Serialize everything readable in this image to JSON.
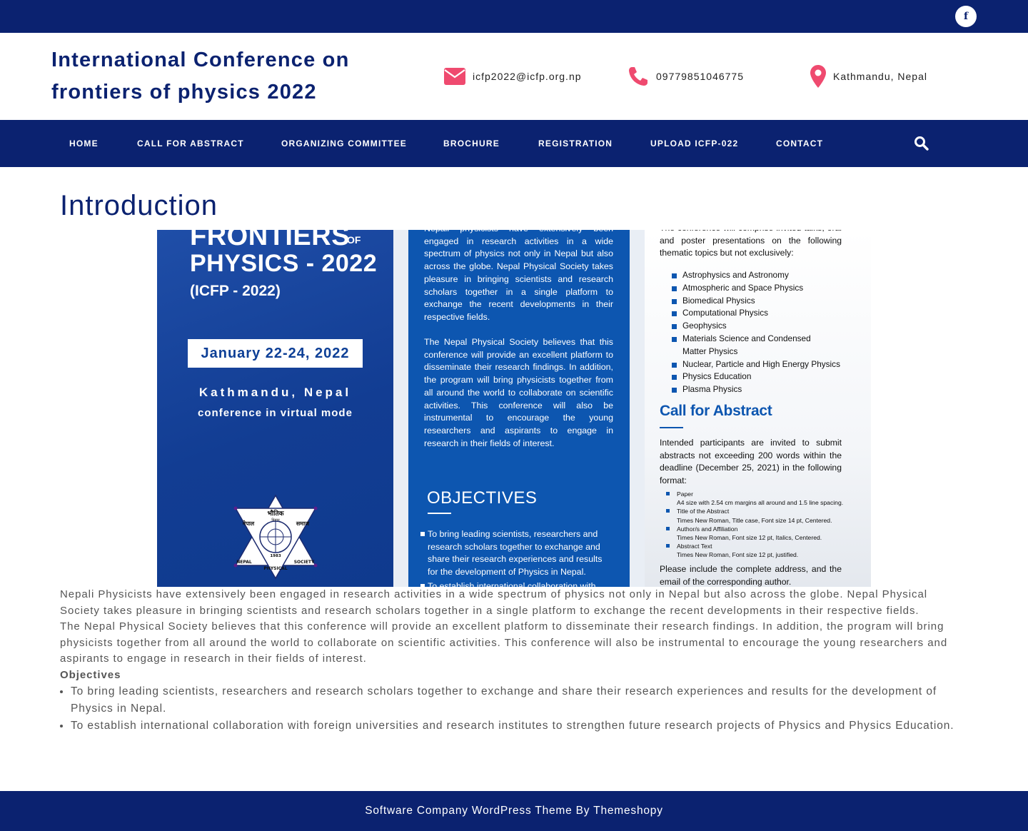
{
  "topbar": {
    "facebook_icon": "facebook-icon",
    "facebook_glyph": "f"
  },
  "header": {
    "title": "International Conference on frontiers of physics 2022",
    "email": {
      "icon": "envelope-icon",
      "text": "icfp2022@icfp.org.np"
    },
    "phone": {
      "icon": "phone-icon",
      "text": "09779851046775"
    },
    "location": {
      "icon": "map-marker-icon",
      "text": "Kathmandu, Nepal"
    }
  },
  "nav": {
    "items": [
      {
        "label": "HOME"
      },
      {
        "label": "CALL FOR ABSTRACT"
      },
      {
        "label": "ORGANIZING COMMITTEE"
      },
      {
        "label": "BROCHURE"
      },
      {
        "label": "REGISTRATION"
      },
      {
        "label": "UPLOAD ICFP-022"
      },
      {
        "label": "CONTACT"
      }
    ],
    "search_icon": "search-icon"
  },
  "page": {
    "title": "Introduction"
  },
  "poster": {
    "left": {
      "title_line1": "FRONTIERS",
      "title_of": "OF",
      "title_line2": "PHYSICS - 2022",
      "abbr": "(ICFP - 2022)",
      "dates": "January 22-24, 2022",
      "location": "Kathmandu, Nepal",
      "mode": "conference in virtual mode",
      "logo": {
        "top": "भौतिक",
        "sub": "विज्ञान",
        "left": "नेपाल",
        "right": "समाज",
        "year": "1983",
        "bottom_left": "NEPAL",
        "bottom_right": "SOCIETY",
        "bottom": "PHYSICAL"
      }
    },
    "middle": {
      "para1": "Nepali physicists have extensively been engaged in research activities in a wide spectrum of physics not only in Nepal but also across the globe. Nepal Physical Society takes pleasure in bringing scientists and research scholars together in a single platform to exchange the recent developments in their respective fields.",
      "para2": "The Nepal Physical Society believes that this conference will provide an excellent platform to disseminate their research findings. In addition, the program will bring physicists together from all around the world to collaborate on scientific activities. This conference will also be instrumental to encourage the young researchers and aspirants to engage in research in their fields of interest.",
      "objectives_title": "OBJECTIVES",
      "objective1": "To bring leading scientists, researchers and research scholars together to exchange and share their research experiences and results for the development of Physics in Nepal.",
      "objective2": "To establish international collaboration with"
    },
    "right": {
      "intro": "The conference will comprise invited talks, oral and poster presentations on the following thematic topics but not exclusively:",
      "topics": [
        "Astrophysics and Astronomy",
        "Atmospheric and Space Physics",
        "Biomedical Physics",
        "Computational Physics",
        "Geophysics",
        "Materials Science and Condensed Matter Physics",
        "Nuclear, Particle and High Energy Physics",
        "Physics Education",
        "Plasma Physics"
      ],
      "call_title": "Call for Abstract",
      "call_text": "Intended participants are invited to submit abstracts not exceeding 200 words within the deadline (December 25, 2021) in the following format:",
      "format": [
        {
          "head": "Paper",
          "detail": "A4 size with 2.54 cm margins all around and 1.5 line spacing."
        },
        {
          "head": "Title of the Abstract",
          "detail": "Times New Roman, Title case, Font size 14 pt, Centered."
        },
        {
          "head": "Author/s and Affiliation",
          "detail": "Times New Roman, Font size 12 pt, Italics, Centered."
        },
        {
          "head": "Abstract Text",
          "detail": "Times New Roman, Font size 12 pt, justified."
        }
      ],
      "closing": "Please include the complete address, and the email of the corresponding author."
    }
  },
  "content": {
    "para1": "Nepali Physicists have extensively been engaged in research activities in a wide spectrum of physics not only in Nepal but also across the globe. Nepal Physical Society takes pleasure in bringing scientists and research scholars together in a single platform to exchange the recent developments in their respective fields.",
    "para2": "The Nepal Physical Society believes that this conference will provide an excellent platform to disseminate their research findings. In addition, the program will bring physicists together from all around the world to collaborate on scientific activities. This conference will also be instrumental to encourage the young researchers and aspirants to engage in research in their fields of interest.",
    "objectives_heading": "Objectives",
    "objectives": [
      "To bring leading scientists, researchers and research scholars together to exchange and share their research experiences and results for the development of Physics in Nepal.",
      "To establish international collaboration with foreign universities and research institutes to strengthen future research projects of Physics and Physics Education."
    ]
  },
  "footer": {
    "text": "Software Company WordPress Theme By Themeshopy"
  },
  "colors": {
    "navy": "#0b2270",
    "accent_pink": "#ef4a6f",
    "poster_blue": "#0d56b0",
    "text_gray": "#555555"
  }
}
